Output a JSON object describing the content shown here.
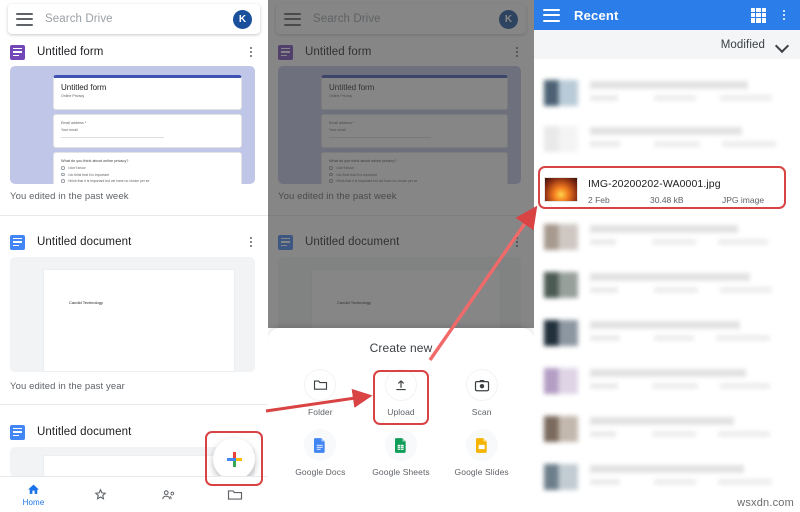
{
  "search": {
    "placeholder": "Search Drive",
    "avatar_initial": "K"
  },
  "left_panel": {
    "items": [
      {
        "icon": "forms-icon",
        "title": "Untitled form",
        "edited": "You edited in the past week"
      },
      {
        "icon": "docs-icon",
        "title": "Untitled document",
        "edited": "You edited in the past year"
      },
      {
        "icon": "docs-icon",
        "title": "Untitled document",
        "edited": ""
      }
    ],
    "form_preview": {
      "title": "Untitled form",
      "subtitle": "Online Privacy",
      "email_label": "Email address *",
      "email_placeholder": "Your email",
      "question": "What do you think about online privacy?",
      "options": [
        "I don't know",
        "I do think that it is important",
        "I think that it is important but we have no choice per se"
      ]
    },
    "doc_preview": {
      "text": "Candid Technology"
    },
    "bottom_nav": [
      {
        "name": "home",
        "label": "Home",
        "active": true
      },
      {
        "name": "starred",
        "label": "",
        "active": false
      },
      {
        "name": "shared",
        "label": "",
        "active": false
      },
      {
        "name": "files",
        "label": "",
        "active": false
      }
    ],
    "fab_label": "Create"
  },
  "mid_panel": {
    "sheet_title": "Create new",
    "options": [
      {
        "name": "folder",
        "label": "Folder",
        "icon": "folder-icon"
      },
      {
        "name": "upload",
        "label": "Upload",
        "icon": "upload-icon"
      },
      {
        "name": "scan",
        "label": "Scan",
        "icon": "camera-icon"
      },
      {
        "name": "google-docs",
        "label": "Google Docs",
        "icon": "docs-icon"
      },
      {
        "name": "google-sheets",
        "label": "Google Sheets",
        "icon": "sheets-icon"
      },
      {
        "name": "google-slides",
        "label": "Google Slides",
        "icon": "slides-icon"
      }
    ]
  },
  "right_panel": {
    "title": "Recent",
    "sort_label": "Modified",
    "highlighted_file": {
      "name": "IMG-20200202-WA0001.jpg",
      "date": "2 Feb",
      "size": "30.48 kB",
      "kind": "JPG image"
    }
  },
  "watermark": "wsxdn.com",
  "colors": {
    "accent_blue": "#2b7de9",
    "annotation_red": "#d94343",
    "forms_purple": "#7248b9",
    "docs_blue": "#4285f4",
    "sheets_green": "#0f9d58",
    "slides_yellow": "#f4b400"
  }
}
